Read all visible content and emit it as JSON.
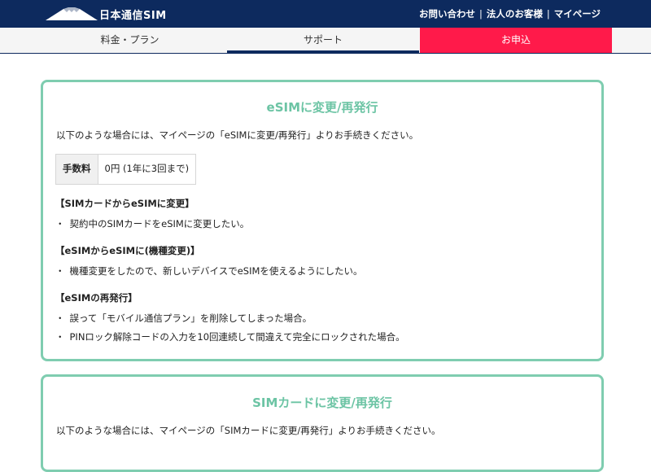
{
  "header": {
    "logo_text": "日本通信SIM",
    "links": [
      "お問い合わせ",
      "法人のお客様",
      "マイページ"
    ],
    "separator": "|"
  },
  "nav": {
    "tabs": [
      {
        "label": "料金・プラン"
      },
      {
        "label": "サポート"
      },
      {
        "label": "お申込"
      }
    ]
  },
  "colors": {
    "header_bg": "#0d2a5e",
    "accent_green": "#7fcdb0",
    "apply_red": "#ff1a4a"
  },
  "esim_card": {
    "title": "eSIMに変更/再発行",
    "intro": "以下のような場合には、マイページの「eSIMに変更/再発行」よりお手続きください。",
    "fee": {
      "label": "手数料",
      "value": "0円 (1年に3回まで)"
    },
    "sections": [
      {
        "heading": "【SIMカードからeSIMに変更】",
        "items": [
          "契約中のSIMカードをeSIMに変更したい。"
        ]
      },
      {
        "heading": "【eSIMからeSIMに(機種変更)】",
        "items": [
          "機種変更をしたので、新しいデバイスでeSIMを使えるようにしたい。"
        ]
      },
      {
        "heading": "【eSIMの再発行】",
        "items": [
          "誤って「モバイル通信プラン」を削除してしまった場合。",
          "PINロック解除コードの入力を10回連続して間違えて完全にロックされた場合。"
        ]
      }
    ],
    "bullet_char": "・"
  },
  "sim_card": {
    "title": "SIMカードに変更/再発行",
    "intro": "以下のような場合には、マイページの「SIMカードに変更/再発行」よりお手続きください。"
  }
}
